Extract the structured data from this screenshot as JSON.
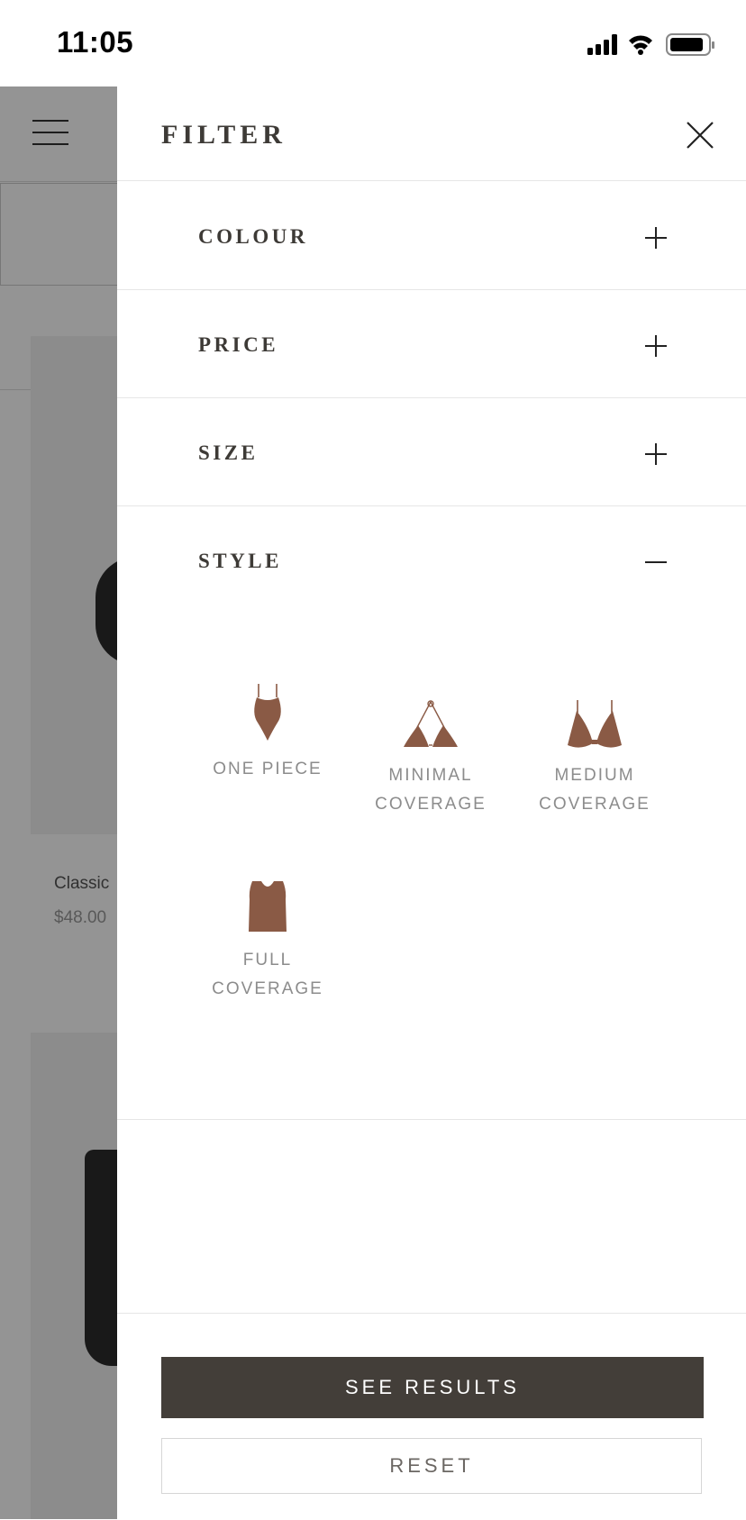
{
  "status_bar": {
    "time": "11:05",
    "icons": [
      "signal-icon",
      "wifi-icon",
      "battery-icon"
    ]
  },
  "background_page": {
    "product": {
      "name": "Classic",
      "price": "$48.00"
    }
  },
  "filter": {
    "title": "FILTER",
    "close_icon": "close-icon",
    "sections": [
      {
        "label": "COLOUR",
        "expanded": false,
        "icon": "plus-icon"
      },
      {
        "label": "PRICE",
        "expanded": false,
        "icon": "plus-icon"
      },
      {
        "label": "SIZE",
        "expanded": false,
        "icon": "plus-icon"
      },
      {
        "label": "STYLE",
        "expanded": true,
        "icon": "minus-icon"
      }
    ],
    "style_options": [
      {
        "label_line1": "ONE PIECE",
        "label_line2": "",
        "icon": "one-piece-swimsuit-icon"
      },
      {
        "label_line1": "MINIMAL",
        "label_line2": "COVERAGE",
        "icon": "triangle-bikini-top-icon"
      },
      {
        "label_line1": "MEDIUM",
        "label_line2": "COVERAGE",
        "icon": "underwire-bikini-top-icon"
      },
      {
        "label_line1": "FULL",
        "label_line2": "COVERAGE",
        "icon": "crop-top-icon"
      }
    ],
    "see_results_label": "SEE RESULTS",
    "reset_label": "RESET"
  },
  "colors": {
    "swatch_brown": "#8a5a45",
    "primary_button": "#433e39",
    "heading_text": "#3d3a36",
    "overlay": "rgba(0,0,0,0.42)"
  }
}
